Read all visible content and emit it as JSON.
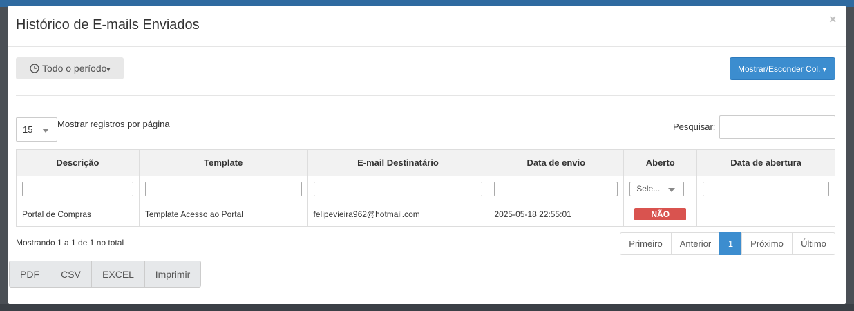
{
  "modal": {
    "title": "Histórico de E-mails Enviados",
    "close_label": "×"
  },
  "toolbar": {
    "period_label": "Todo o período",
    "period_caret": "▾",
    "columns_label": "Mostrar/Esconder Col.",
    "columns_caret": "▾"
  },
  "table_controls": {
    "page_size_value": "15",
    "page_size_label": "Mostrar registros por página",
    "search_label": "Pesquisar:",
    "search_value": ""
  },
  "table": {
    "headers": [
      "Descrição",
      "Template",
      "E-mail Destinatário",
      "Data de envio",
      "Aberto",
      "Data de abertura"
    ],
    "opened_filter_placeholder": "Sele...",
    "rows": [
      {
        "descricao": "Portal de Compras",
        "template": "Template Acesso ao Portal",
        "email": "felipevieira962@hotmail.com",
        "data_envio": "2025-05-18 22:55:01",
        "aberto": "NÃO",
        "data_abertura": ""
      }
    ]
  },
  "footer": {
    "info": "Mostrando 1 a 1 de 1 no total",
    "pager": {
      "first": "Primeiro",
      "prev": "Anterior",
      "current": "1",
      "next": "Próximo",
      "last": "Último"
    },
    "export": {
      "pdf": "PDF",
      "csv": "CSV",
      "excel": "EXCEL",
      "print": "Imprimir"
    }
  },
  "colors": {
    "primary": "#3c8dcf",
    "danger": "#d9534f"
  }
}
